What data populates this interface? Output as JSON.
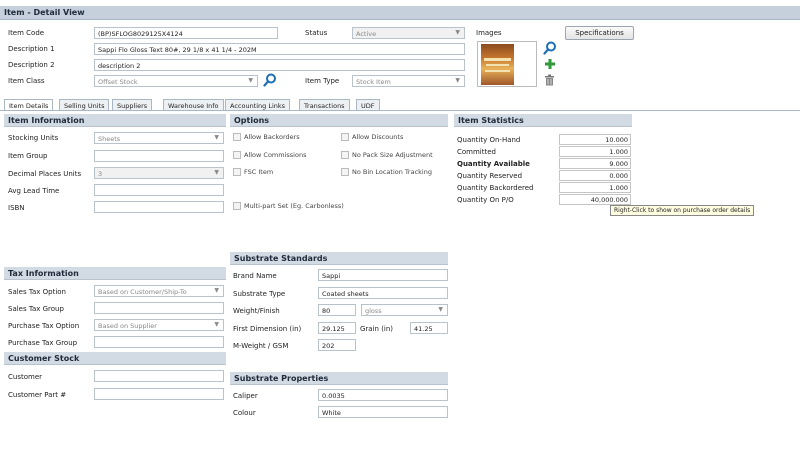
{
  "header": {
    "title": "Item - Detail View"
  },
  "fields": {
    "item_code_label": "Item Code",
    "item_code_value": "(BP)SFLOG8029125X4124",
    "status_label": "Status",
    "status_value": "Active",
    "description1_label": "Description 1",
    "description1_value": "Sappi Flo Gloss Text 80#, 29 1/8 x 41 1/4 - 202M",
    "description2_label": "Description 2",
    "description2_value": "description 2",
    "item_class_label": "Item Class",
    "item_class_value": "Offset Stock",
    "item_type_label": "Item Type",
    "item_type_value": "Stock Item",
    "images_label": "Images",
    "specifications_button": "Specifications"
  },
  "tabs": [
    "Item Details",
    "Selling Units",
    "Suppliers",
    "Warehouse Info",
    "Accounting Links",
    "Transactions",
    "UDF"
  ],
  "item_information": {
    "title": "Item Information",
    "stocking_units_label": "Stocking Units",
    "stocking_units_value": "Sheets",
    "item_group_label": "Item Group",
    "decimal_places_label": "Decimal Places Units",
    "decimal_places_value": "3",
    "avg_lead_time_label": "Avg Lead Time",
    "isbn_label": "ISBN"
  },
  "options": {
    "title": "Options",
    "allow_backorders": "Allow Backorders",
    "allow_discounts": "Allow Discounts",
    "allow_commissions": "Allow Commissions",
    "no_pack_size": "No Pack Size Adjustment",
    "fsc_item": "FSC Item",
    "no_bin_location": "No Bin Location Tracking",
    "multipart_set": "Multi-part Set (Eg. Carbonless)"
  },
  "item_statistics": {
    "title": "Item Statistics",
    "rows": [
      {
        "label": "Quantity On-Hand",
        "value": "10.000"
      },
      {
        "label": "Committed",
        "value": "1.000"
      },
      {
        "label": "Quantity Available",
        "value": "9.000"
      },
      {
        "label": "Quantity Reserved",
        "value": "0.000"
      },
      {
        "label": "Quantity Backordered",
        "value": "1.000"
      },
      {
        "label": "Quantity On P/O",
        "value": "40,000.000"
      }
    ],
    "tooltip": "Right-Click to show on purchase order details"
  },
  "tax_information": {
    "title": "Tax Information",
    "sales_tax_option_label": "Sales Tax Option",
    "sales_tax_option_value": "Based on Customer/Ship-To",
    "sales_tax_group_label": "Sales Tax Group",
    "purchase_tax_option_label": "Purchase Tax Option",
    "purchase_tax_option_value": "Based on Supplier",
    "purchase_tax_group_label": "Purchase Tax Group"
  },
  "customer_stock": {
    "title": "Customer Stock",
    "customer_label": "Customer",
    "customer_part_label": "Customer Part #"
  },
  "substrate_standards": {
    "title": "Substrate Standards",
    "brand_name_label": "Brand Name",
    "brand_name_value": "Sappi",
    "substrate_type_label": "Substrate Type",
    "substrate_type_value": "Coated sheets",
    "weight_finish_label": "Weight/Finish",
    "weight_value": "80",
    "finish_value": "gloss",
    "first_dimension_label": "First Dimension (in)",
    "first_dimension_value": "29.125",
    "grain_label": "Grain (in)",
    "grain_value": "41.25",
    "mweight_label": "M-Weight / GSM",
    "mweight_value": "202"
  },
  "substrate_properties": {
    "title": "Substrate Properties",
    "caliper_label": "Caliper",
    "caliper_value": "0.0035",
    "colour_label": "Colour",
    "colour_value": "White"
  },
  "icons": {
    "search": "search-icon",
    "add": "plus-icon",
    "delete": "trash-icon",
    "dropdown": "chevron-down-icon"
  },
  "colors": {
    "header_bg": "#c5d0dc",
    "section_bg": "#d2dae3",
    "search_icon": "#1e6fb8",
    "add_icon": "#2f9a3a",
    "tooltip_bg": "#fffde0"
  }
}
